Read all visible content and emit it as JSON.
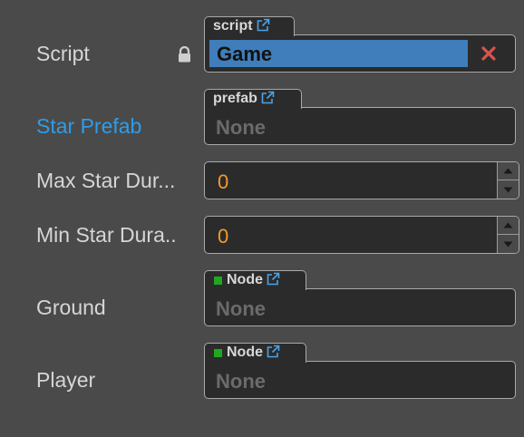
{
  "rows": {
    "script": {
      "label": "Script",
      "tag": "script",
      "value": "Game"
    },
    "star_prefab": {
      "label": "Star Prefab",
      "tag": "prefab",
      "value": "None"
    },
    "max_star_duration": {
      "label": "Max Star Dur...",
      "value": "0"
    },
    "min_star_duration": {
      "label": "Min Star Dura..",
      "value": "0"
    },
    "ground": {
      "label": "Ground",
      "tag": "Node",
      "value": "None"
    },
    "player": {
      "label": "Player",
      "tag": "Node",
      "value": "None"
    }
  },
  "icons": {
    "lock": "lock-icon",
    "link": "external-link-icon",
    "clear": "close-icon",
    "node": "node-icon",
    "step_up": "triangle-up-icon",
    "step_down": "triangle-down-icon"
  },
  "colors": {
    "highlight_label": "#2f9ce8",
    "number_value": "#f29a2e",
    "selection": "#3f7ebb",
    "clear": "#d9534f",
    "node_dot": "#1fa81f"
  }
}
